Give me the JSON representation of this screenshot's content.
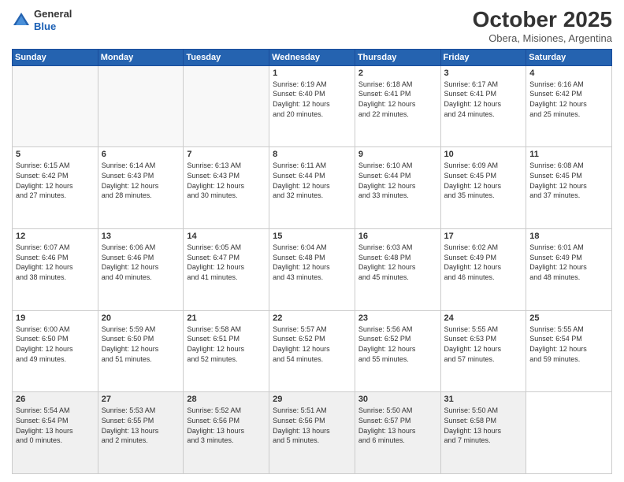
{
  "header": {
    "logo_line1": "General",
    "logo_line2": "Blue",
    "month": "October 2025",
    "location": "Obera, Misiones, Argentina"
  },
  "weekdays": [
    "Sunday",
    "Monday",
    "Tuesday",
    "Wednesday",
    "Thursday",
    "Friday",
    "Saturday"
  ],
  "weeks": [
    [
      {
        "day": "",
        "info": ""
      },
      {
        "day": "",
        "info": ""
      },
      {
        "day": "",
        "info": ""
      },
      {
        "day": "1",
        "info": "Sunrise: 6:19 AM\nSunset: 6:40 PM\nDaylight: 12 hours\nand 20 minutes."
      },
      {
        "day": "2",
        "info": "Sunrise: 6:18 AM\nSunset: 6:41 PM\nDaylight: 12 hours\nand 22 minutes."
      },
      {
        "day": "3",
        "info": "Sunrise: 6:17 AM\nSunset: 6:41 PM\nDaylight: 12 hours\nand 24 minutes."
      },
      {
        "day": "4",
        "info": "Sunrise: 6:16 AM\nSunset: 6:42 PM\nDaylight: 12 hours\nand 25 minutes."
      }
    ],
    [
      {
        "day": "5",
        "info": "Sunrise: 6:15 AM\nSunset: 6:42 PM\nDaylight: 12 hours\nand 27 minutes."
      },
      {
        "day": "6",
        "info": "Sunrise: 6:14 AM\nSunset: 6:43 PM\nDaylight: 12 hours\nand 28 minutes."
      },
      {
        "day": "7",
        "info": "Sunrise: 6:13 AM\nSunset: 6:43 PM\nDaylight: 12 hours\nand 30 minutes."
      },
      {
        "day": "8",
        "info": "Sunrise: 6:11 AM\nSunset: 6:44 PM\nDaylight: 12 hours\nand 32 minutes."
      },
      {
        "day": "9",
        "info": "Sunrise: 6:10 AM\nSunset: 6:44 PM\nDaylight: 12 hours\nand 33 minutes."
      },
      {
        "day": "10",
        "info": "Sunrise: 6:09 AM\nSunset: 6:45 PM\nDaylight: 12 hours\nand 35 minutes."
      },
      {
        "day": "11",
        "info": "Sunrise: 6:08 AM\nSunset: 6:45 PM\nDaylight: 12 hours\nand 37 minutes."
      }
    ],
    [
      {
        "day": "12",
        "info": "Sunrise: 6:07 AM\nSunset: 6:46 PM\nDaylight: 12 hours\nand 38 minutes."
      },
      {
        "day": "13",
        "info": "Sunrise: 6:06 AM\nSunset: 6:46 PM\nDaylight: 12 hours\nand 40 minutes."
      },
      {
        "day": "14",
        "info": "Sunrise: 6:05 AM\nSunset: 6:47 PM\nDaylight: 12 hours\nand 41 minutes."
      },
      {
        "day": "15",
        "info": "Sunrise: 6:04 AM\nSunset: 6:48 PM\nDaylight: 12 hours\nand 43 minutes."
      },
      {
        "day": "16",
        "info": "Sunrise: 6:03 AM\nSunset: 6:48 PM\nDaylight: 12 hours\nand 45 minutes."
      },
      {
        "day": "17",
        "info": "Sunrise: 6:02 AM\nSunset: 6:49 PM\nDaylight: 12 hours\nand 46 minutes."
      },
      {
        "day": "18",
        "info": "Sunrise: 6:01 AM\nSunset: 6:49 PM\nDaylight: 12 hours\nand 48 minutes."
      }
    ],
    [
      {
        "day": "19",
        "info": "Sunrise: 6:00 AM\nSunset: 6:50 PM\nDaylight: 12 hours\nand 49 minutes."
      },
      {
        "day": "20",
        "info": "Sunrise: 5:59 AM\nSunset: 6:50 PM\nDaylight: 12 hours\nand 51 minutes."
      },
      {
        "day": "21",
        "info": "Sunrise: 5:58 AM\nSunset: 6:51 PM\nDaylight: 12 hours\nand 52 minutes."
      },
      {
        "day": "22",
        "info": "Sunrise: 5:57 AM\nSunset: 6:52 PM\nDaylight: 12 hours\nand 54 minutes."
      },
      {
        "day": "23",
        "info": "Sunrise: 5:56 AM\nSunset: 6:52 PM\nDaylight: 12 hours\nand 55 minutes."
      },
      {
        "day": "24",
        "info": "Sunrise: 5:55 AM\nSunset: 6:53 PM\nDaylight: 12 hours\nand 57 minutes."
      },
      {
        "day": "25",
        "info": "Sunrise: 5:55 AM\nSunset: 6:54 PM\nDaylight: 12 hours\nand 59 minutes."
      }
    ],
    [
      {
        "day": "26",
        "info": "Sunrise: 5:54 AM\nSunset: 6:54 PM\nDaylight: 13 hours\nand 0 minutes."
      },
      {
        "day": "27",
        "info": "Sunrise: 5:53 AM\nSunset: 6:55 PM\nDaylight: 13 hours\nand 2 minutes."
      },
      {
        "day": "28",
        "info": "Sunrise: 5:52 AM\nSunset: 6:56 PM\nDaylight: 13 hours\nand 3 minutes."
      },
      {
        "day": "29",
        "info": "Sunrise: 5:51 AM\nSunset: 6:56 PM\nDaylight: 13 hours\nand 5 minutes."
      },
      {
        "day": "30",
        "info": "Sunrise: 5:50 AM\nSunset: 6:57 PM\nDaylight: 13 hours\nand 6 minutes."
      },
      {
        "day": "31",
        "info": "Sunrise: 5:50 AM\nSunset: 6:58 PM\nDaylight: 13 hours\nand 7 minutes."
      },
      {
        "day": "",
        "info": ""
      }
    ]
  ]
}
